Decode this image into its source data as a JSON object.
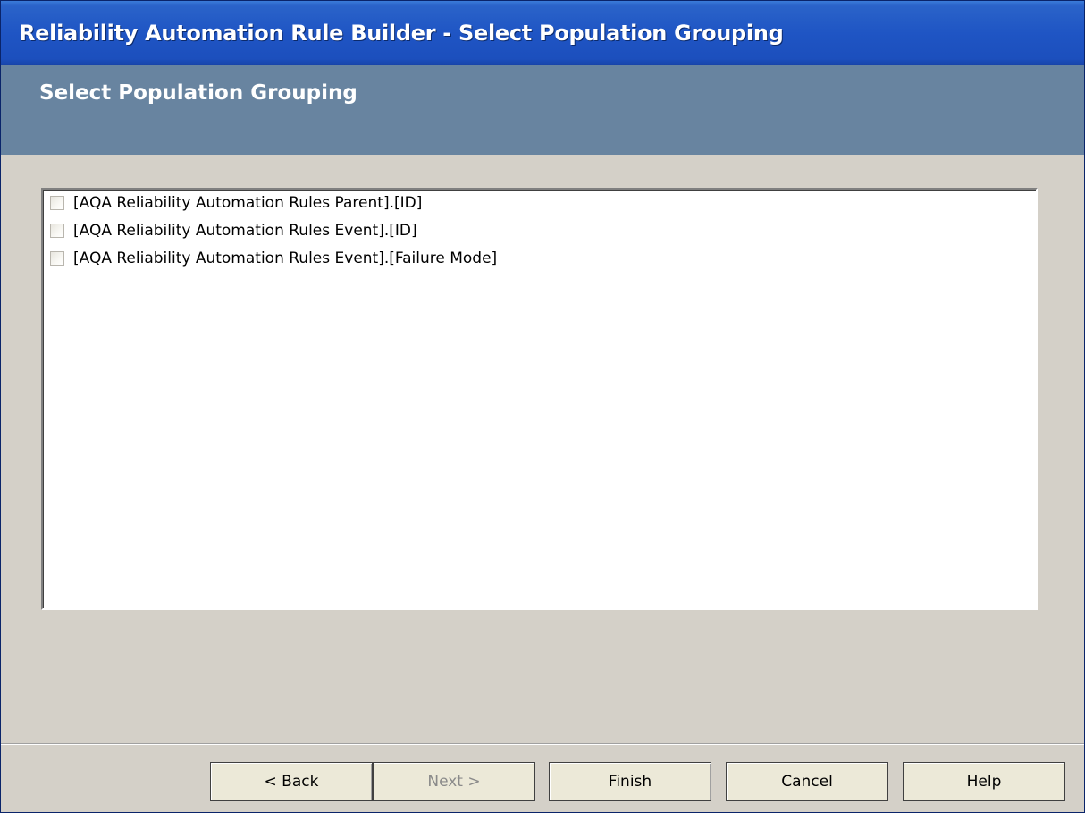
{
  "window": {
    "title": "Reliability Automation Rule Builder - Select Population Grouping"
  },
  "header": {
    "heading": "Select Population Grouping"
  },
  "list": {
    "items": [
      {
        "label": "[AQA Reliability Automation Rules Parent].[ID]",
        "checked": false
      },
      {
        "label": "[AQA Reliability Automation Rules Event].[ID]",
        "checked": false
      },
      {
        "label": "[AQA Reliability Automation Rules Event].[Failure Mode]",
        "checked": false
      }
    ]
  },
  "buttons": {
    "back": "< Back",
    "next": "Next >",
    "finish": "Finish",
    "cancel": "Cancel",
    "help": "Help"
  },
  "colors": {
    "titlebar": "#1f55c4",
    "header": "#6884a0",
    "dialog_background": "#d4d0c8"
  }
}
